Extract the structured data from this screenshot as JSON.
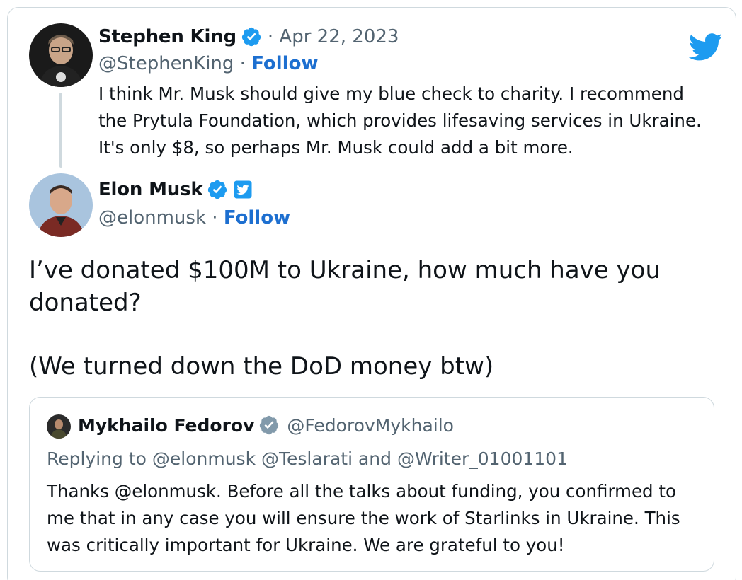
{
  "colors": {
    "accent": "#1d9bf0",
    "follow": "#1d6fd0",
    "muted": "#536471",
    "text": "#0f1419",
    "border": "#cfd9de",
    "gray_badge": "#829aab"
  },
  "icons": {
    "brand": "twitter-bird-icon",
    "verified": "verified-badge-icon",
    "affiliate": "twitter-affiliate-icon"
  },
  "parent_tweet": {
    "name": "Stephen King",
    "date": "· Apr 22, 2023",
    "handle": "@StephenKing",
    "separator": " · ",
    "follow": "Follow",
    "text": "I think Mr. Musk should give my blue check to charity. I recommend the Prytula Foundation, which provides lifesaving services in Ukraine. It's only $8, so perhaps Mr. Musk could add a bit more."
  },
  "reply_tweet": {
    "name": "Elon Musk",
    "handle": "@elonmusk",
    "separator": " · ",
    "follow": "Follow",
    "text_line1": "I’ve donated $100M to Ukraine, how much have you donated?",
    "text_line2": "(We turned down the DoD money btw)"
  },
  "quoted_tweet": {
    "name": "Mykhailo Fedorov",
    "handle": "@FedorovMykhailo",
    "replying_to": "Replying to @elonmusk @Teslarati and @Writer_01001101",
    "text": "Thanks @elonmusk. Before all the talks about funding, you confirmed to me that in any case you will ensure the work of Starlinks in Ukraine. This was critically important for Ukraine. We are grateful to you!"
  }
}
